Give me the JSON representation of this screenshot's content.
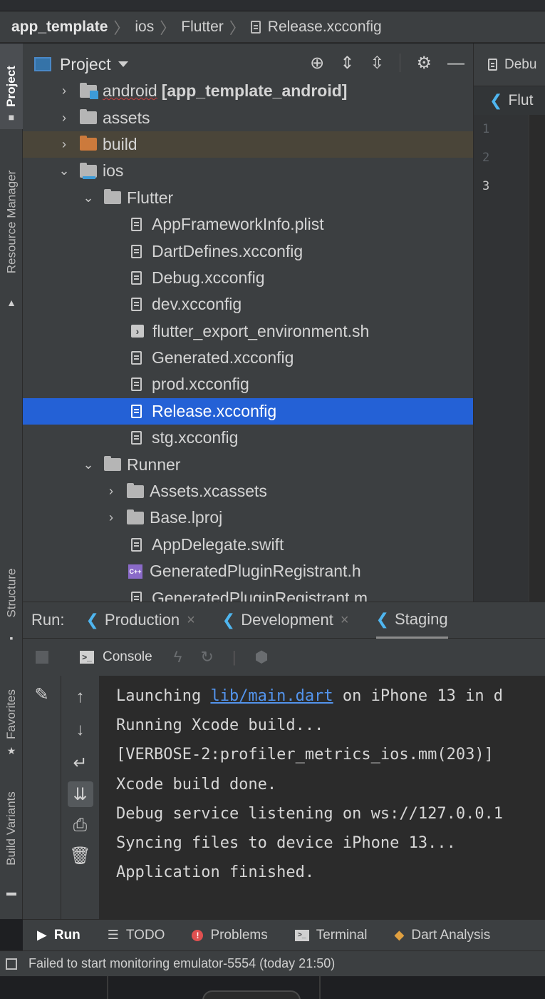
{
  "breadcrumb": {
    "root": "app_template",
    "part1": "ios",
    "part2": "Flutter",
    "file": "Release.xcconfig"
  },
  "left_strip": {
    "project": "Project",
    "resource_manager": "Resource Manager",
    "structure": "Structure",
    "favorites": "Favorites",
    "build_variants": "Build Variants"
  },
  "project_panel": {
    "title": "Project",
    "tree": [
      {
        "label": "android",
        "suffix": "[app_template_android]"
      },
      {
        "label": "assets"
      },
      {
        "label": "build"
      },
      {
        "label": "ios"
      },
      {
        "label": "Flutter"
      },
      {
        "label": "AppFrameworkInfo.plist"
      },
      {
        "label": "DartDefines.xcconfig"
      },
      {
        "label": "Debug.xcconfig"
      },
      {
        "label": "dev.xcconfig"
      },
      {
        "label": "flutter_export_environment.sh"
      },
      {
        "label": "Generated.xcconfig"
      },
      {
        "label": "prod.xcconfig"
      },
      {
        "label": "Release.xcconfig"
      },
      {
        "label": "stg.xcconfig"
      },
      {
        "label": "Runner"
      },
      {
        "label": "Assets.xcassets"
      },
      {
        "label": "Base.lproj"
      },
      {
        "label": "AppDelegate.swift"
      },
      {
        "label": "GeneratedPluginRegistrant.h"
      },
      {
        "label": "GeneratedPluginRegistrant.m"
      }
    ]
  },
  "editor": {
    "tab1": "Debu",
    "tab2": "Flut",
    "lines": [
      "1",
      "2",
      "3"
    ]
  },
  "run": {
    "label": "Run:",
    "tabs": [
      {
        "label": "Production"
      },
      {
        "label": "Development"
      },
      {
        "label": "Staging"
      }
    ],
    "console_tab": "Console",
    "output": {
      "l1_pre": "Launching ",
      "l1_link": "lib/main.dart",
      "l1_post": " on iPhone 13 in d",
      "l2": "Running Xcode build...",
      "l3": "[VERBOSE-2:profiler_metrics_ios.mm(203)]",
      "l4": "Xcode build done.",
      "l5": "Debug service listening on ws://127.0.0.1",
      "l6": "Syncing files to device iPhone 13...",
      "l7": "Application finished."
    }
  },
  "bottom_bar": {
    "run": "Run",
    "todo": "TODO",
    "problems": "Problems",
    "terminal": "Terminal",
    "dart_analysis": "Dart Analysis"
  },
  "status": {
    "message": "Failed to start monitoring emulator-5554 (today 21:50)"
  },
  "colors": {
    "selection": "#2461d6",
    "link": "#5394ec",
    "flutter": "#4fb6f0"
  }
}
